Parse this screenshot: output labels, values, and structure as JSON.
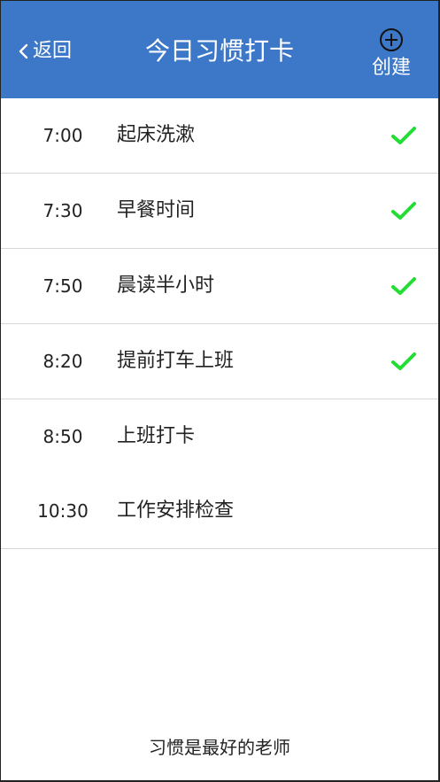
{
  "header": {
    "back_label": "返回",
    "title": "今日习惯打卡",
    "create_label": "创建",
    "background_color": "#3d78c8"
  },
  "habits": [
    {
      "time": "7:00",
      "name": "起床洗漱",
      "done": true
    },
    {
      "time": "7:30",
      "name": "早餐时间",
      "done": true
    },
    {
      "time": "7:50",
      "name": "晨读半小时",
      "done": true
    },
    {
      "time": "8:20",
      "name": "提前打车上班",
      "done": true
    },
    {
      "time": "8:50",
      "name": "上班打卡",
      "done": false
    },
    {
      "time": "10:30",
      "name": "工作安排检查",
      "done": false
    }
  ],
  "check_color": "#22dd33",
  "footer": {
    "text": "习惯是最好的老师"
  }
}
